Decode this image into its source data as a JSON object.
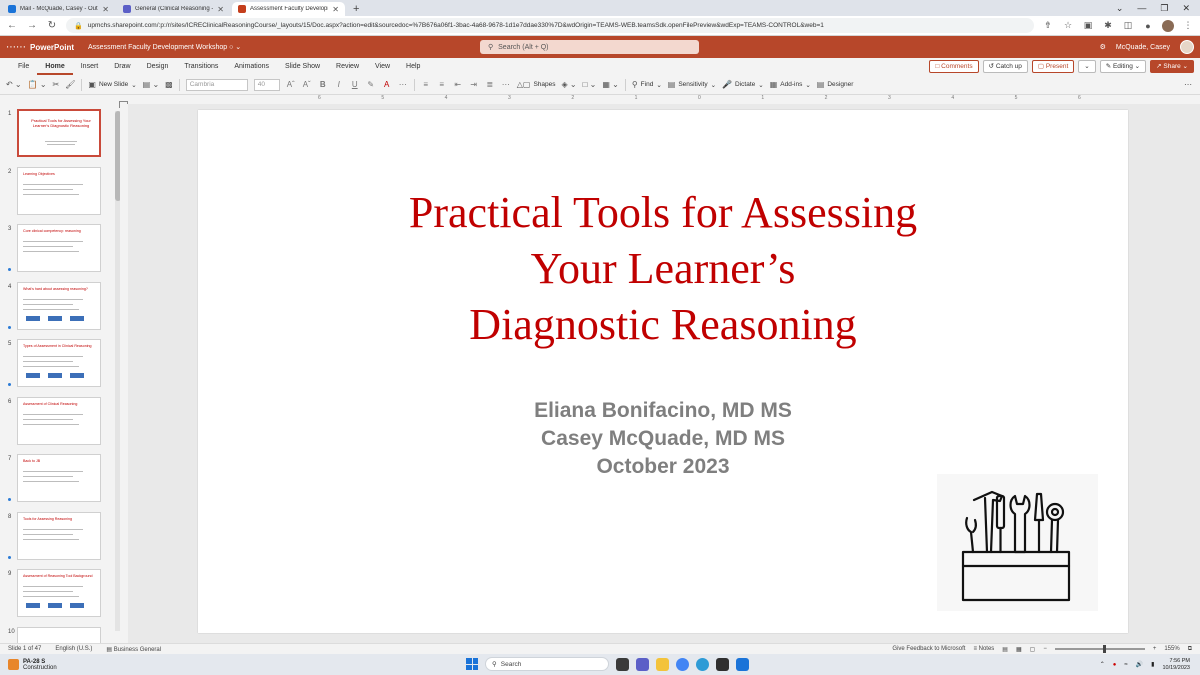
{
  "browser": {
    "tabs": [
      {
        "title": "Mail - McQuade, Casey - Outlo",
        "icon_color": "#1a73d8",
        "active": false
      },
      {
        "title": "General (Clinical Reasoning - by",
        "icon_color": "#5b5fc7",
        "active": false
      },
      {
        "title": "Assessment Faculty Developm",
        "icon_color": "#c43e1c",
        "active": true
      }
    ],
    "new_tab": "+",
    "url": "upmchs.sharepoint.com/:p:/r/sites/ICREClinicalReasoningCourse/_layouts/15/Doc.aspx?action=edit&sourcedoc=%7B676a06f1-3bac-4a68-9678-1d1e7ddae330%7D&wdOrigin=TEAMS-WEB.teamsSdk.openFilePreview&wdExp=TEAMS-CONTROL&web=1"
  },
  "app": {
    "name": "PowerPoint",
    "doc_title": "Assessment Faculty Development Workshop",
    "search_placeholder": "Search (Alt + Q)",
    "user_name": "McQuade, Casey",
    "accent": "#b7472a"
  },
  "ribbon": {
    "tabs": [
      "File",
      "Home",
      "Insert",
      "Draw",
      "Design",
      "Transitions",
      "Animations",
      "Slide Show",
      "Review",
      "View",
      "Help"
    ],
    "active_tab": "Home",
    "comments": "Comments",
    "catch_up": "Catch up",
    "present": "Present",
    "editing": "Editing",
    "share": "Share"
  },
  "toolbar": {
    "new_slide": "New Slide",
    "font_name": "Cambria",
    "font_size": "40",
    "shapes": "Shapes",
    "find": "Find",
    "sensitivity": "Sensitivity",
    "dictate": "Dictate",
    "addins": "Add-ins",
    "designer": "Designer"
  },
  "thumbnails": [
    {
      "num": "1",
      "title": "Practical Tools for Assessing Your Learner's Diagnostic Reasoning",
      "active": true
    },
    {
      "num": "2",
      "title": "Learning Objectives",
      "active": false
    },
    {
      "num": "3",
      "title": "Core clinical competency: reasoning",
      "active": false
    },
    {
      "num": "4",
      "title": "What's hard about assessing reasoning?",
      "active": false
    },
    {
      "num": "5",
      "title": "Types of Assessment in Clinical Reasoning",
      "active": false
    },
    {
      "num": "6",
      "title": "Assessment of Clinical Reasoning",
      "active": false
    },
    {
      "num": "7",
      "title": "Back to JB",
      "active": false
    },
    {
      "num": "8",
      "title": "Tools for Assessing Reasoning",
      "active": false
    },
    {
      "num": "9",
      "title": "Assessment of Reasoning Tool Background",
      "active": false
    },
    {
      "num": "10",
      "title": "",
      "active": false
    }
  ],
  "ruler": {
    "labels": [
      "6",
      "5",
      "4",
      "3",
      "2",
      "1",
      "0",
      "1",
      "2",
      "3",
      "4",
      "5",
      "6"
    ]
  },
  "slide": {
    "title_lines": [
      "Practical Tools for Assessing",
      "Your Learner’s",
      "Diagnostic Reasoning"
    ],
    "author_lines": [
      "Eliana Bonifacino, MD MS",
      "Casey McQuade, MD MS",
      "October 2023"
    ],
    "title_color": "#c00000",
    "author_color": "#7f7f7f"
  },
  "status": {
    "slide_count": "Slide 1 of 47",
    "language": "English (U.S.)",
    "sensitivity": "Business General",
    "feedback": "Give Feedback to Microsoft",
    "notes": "Notes",
    "zoom": "155%",
    "zoom_level": 0.55
  },
  "taskbar": {
    "weather_title": "PA-28 S",
    "weather_sub": "Construction",
    "search_placeholder": "Search",
    "time": "7:56 PM",
    "date": "10/19/2023"
  }
}
